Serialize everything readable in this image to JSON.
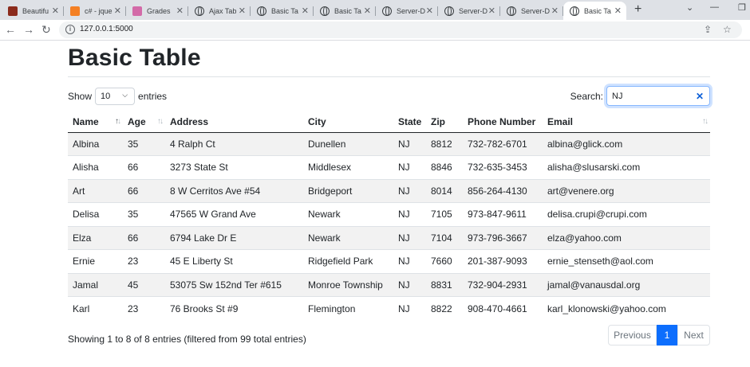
{
  "browser": {
    "tabs": [
      {
        "label": "Beautifu",
        "icon": "site-favicon-icon",
        "color": "#8b2b1c"
      },
      {
        "label": "c# - jque",
        "icon": "stackoverflow-icon",
        "color": "#f48024"
      },
      {
        "label": "Grades",
        "icon": "grades-icon",
        "color": "#d36aa8"
      },
      {
        "label": "Ajax Tab",
        "icon": "globe-icon"
      },
      {
        "label": "Basic Ta",
        "icon": "globe-icon"
      },
      {
        "label": "Basic Ta",
        "icon": "globe-icon"
      },
      {
        "label": "Server-D",
        "icon": "globe-icon"
      },
      {
        "label": "Server-D",
        "icon": "globe-icon"
      },
      {
        "label": "Server-D",
        "icon": "globe-icon"
      },
      {
        "label": "Basic Ta",
        "icon": "globe-icon",
        "active": true
      }
    ],
    "url": "127.0.0.1:5000"
  },
  "page": {
    "title": "Basic Table",
    "length_prefix": "Show",
    "length_value": "10",
    "length_suffix": "entries",
    "search_label": "Search:",
    "search_value": "NJ",
    "columns": [
      "Name",
      "Age",
      "Address",
      "City",
      "State",
      "Zip",
      "Phone Number",
      "Email"
    ],
    "rows": [
      [
        "Albina",
        "35",
        "4 Ralph Ct",
        "Dunellen",
        "NJ",
        "8812",
        "732-782-6701",
        "albina@glick.com"
      ],
      [
        "Alisha",
        "66",
        "3273 State St",
        "Middlesex",
        "NJ",
        "8846",
        "732-635-3453",
        "alisha@slusarski.com"
      ],
      [
        "Art",
        "66",
        "8 W Cerritos Ave #54",
        "Bridgeport",
        "NJ",
        "8014",
        "856-264-4130",
        "art@venere.org"
      ],
      [
        "Delisa",
        "35",
        "47565 W Grand Ave",
        "Newark",
        "NJ",
        "7105",
        "973-847-9611",
        "delisa.crupi@crupi.com"
      ],
      [
        "Elza",
        "66",
        "6794 Lake Dr E",
        "Newark",
        "NJ",
        "7104",
        "973-796-3667",
        "elza@yahoo.com"
      ],
      [
        "Ernie",
        "23",
        "45 E Liberty St",
        "Ridgefield Park",
        "NJ",
        "7660",
        "201-387-9093",
        "ernie_stenseth@aol.com"
      ],
      [
        "Jamal",
        "45",
        "53075 Sw 152nd Ter #615",
        "Monroe Township",
        "NJ",
        "8831",
        "732-904-2931",
        "jamal@vanausdal.org"
      ],
      [
        "Karl",
        "23",
        "76 Brooks St #9",
        "Flemington",
        "NJ",
        "8822",
        "908-470-4661",
        "karl_klonowski@yahoo.com"
      ]
    ],
    "info": "Showing 1 to 8 of 8 entries (filtered from 99 total entries)",
    "pagination": {
      "previous": "Previous",
      "current": "1",
      "next": "Next"
    }
  },
  "colors": {
    "accent": "#0d6efd",
    "stripe": "#f2f2f2",
    "tabstrip": "#dee1e6"
  }
}
